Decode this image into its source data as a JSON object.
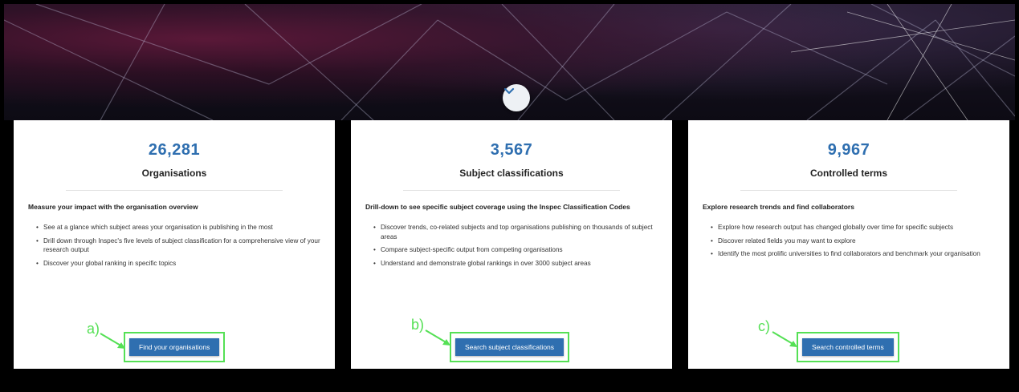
{
  "hero": {
    "scroll_icon": "chevron-down-icon"
  },
  "cards": [
    {
      "count": "26,281",
      "title": "Organisations",
      "lead": "Measure your impact with the organisation overview",
      "bullets": [
        "See at a glance which subject areas your organisation is publishing in the most",
        "Drill down through Inspec's five levels of subject classification for a comprehensive view of your research output",
        "Discover your global ranking in specific topics"
      ],
      "button": "Find your organisations",
      "annotation": "a)"
    },
    {
      "count": "3,567",
      "title": "Subject classifications",
      "lead": "Drill-down to see specific subject coverage using the Inspec Classification Codes",
      "bullets": [
        "Discover trends, co-related subjects and top organisations publishing on thousands of subject areas",
        "Compare subject-specific output from competing organisations",
        "Understand and demonstrate global rankings in over 3000 subject areas"
      ],
      "button": "Search subject classifications",
      "annotation": "b)"
    },
    {
      "count": "9,967",
      "title": "Controlled terms",
      "lead": "Explore research trends and find collaborators",
      "bullets": [
        "Explore how research output has changed globally over time for specific subjects",
        "Discover related fields you may want to explore",
        "Identify the most prolific universities to find collaborators and benchmark your organisation"
      ],
      "button": "Search controlled terms",
      "annotation": "c)"
    }
  ],
  "colors": {
    "accent": "#2f6fb0",
    "annotation": "#55e055"
  }
}
